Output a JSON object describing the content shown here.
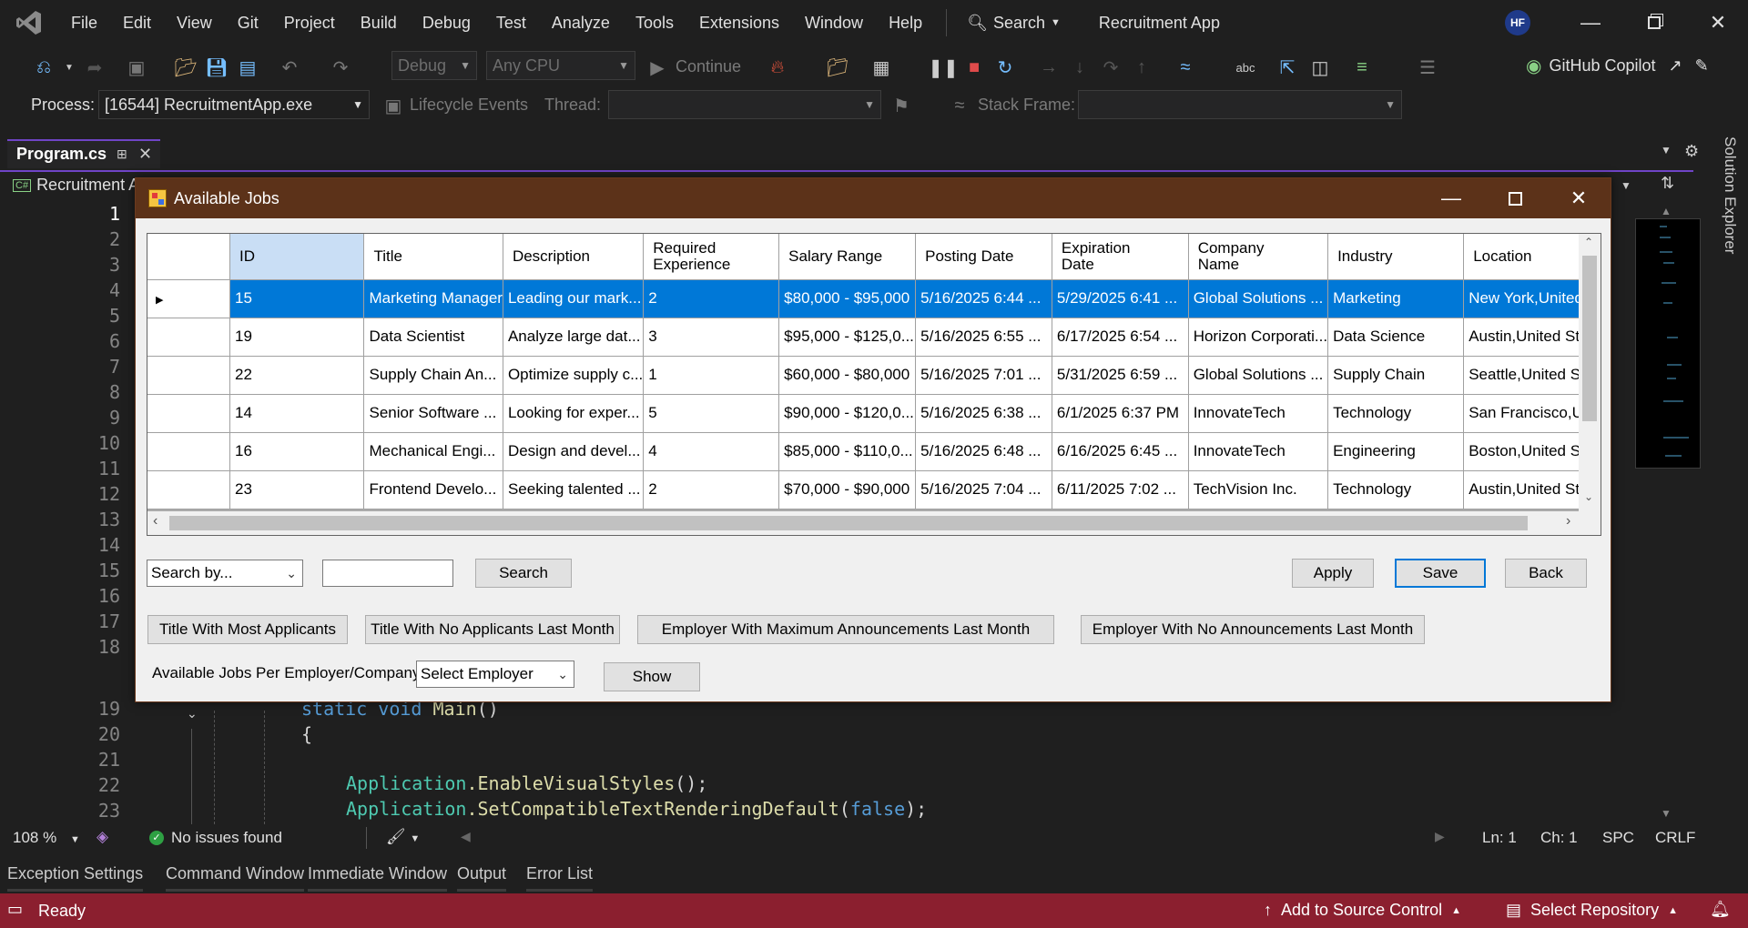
{
  "menubar": {
    "items": [
      "File",
      "Edit",
      "View",
      "Git",
      "Project",
      "Build",
      "Debug",
      "Test",
      "Analyze",
      "Tools",
      "Extensions",
      "Window",
      "Help"
    ],
    "search_label": "Search",
    "app_title": "Recruitment App",
    "avatar_initials": "HF"
  },
  "toolbar": {
    "config": "Debug",
    "platform": "Any CPU",
    "continue_label": "Continue",
    "copilot_label": "GitHub Copilot",
    "process_label": "Process:",
    "process_value": "[16544] RecruitmentApp.exe",
    "lifecycle_label": "Lifecycle Events",
    "thread_label": "Thread:",
    "stackframe_label": "Stack Frame:"
  },
  "tabs": {
    "active_file": "Program.cs",
    "project_nav": "Recruitment A",
    "solution_explorer": "Solution Explorer"
  },
  "editor": {
    "line_numbers_top": [
      "1",
      "2",
      "3",
      "4",
      "5",
      "6",
      "7",
      "8",
      "9",
      "10",
      "11",
      "12",
      "13",
      "14",
      "15",
      "16",
      "17",
      "18"
    ],
    "line_numbers_bottom": [
      "19",
      "20",
      "21",
      "22",
      "23"
    ],
    "code": {
      "l19_kw1": "static",
      "l19_kw2": "void",
      "l19_name": "Main",
      "l19_paren": "()",
      "l20": "{",
      "l22_class": "Application",
      "l22_method": ".EnableVisualStyles",
      "l22_rest": "();",
      "l23_class": "Application",
      "l23_method": ".SetCompatibleTextRenderingDefault",
      "l23_open": "(",
      "l23_kw": "false",
      "l23_close": ");"
    }
  },
  "editor_status": {
    "zoom": "108 %",
    "issues": "No issues found",
    "line": "Ln: 1",
    "char": "Ch: 1",
    "spacing": "SPC",
    "line_ending": "CRLF"
  },
  "bottom_tabs": [
    "Exception Settings",
    "Command Window",
    "Immediate Window",
    "Output",
    "Error List"
  ],
  "statusbar": {
    "ready": "Ready",
    "source_control": "Add to Source Control",
    "repository": "Select Repository"
  },
  "dialog": {
    "title": "Available Jobs",
    "grid": {
      "headers": [
        "ID",
        "Title",
        "Description",
        "Required\nExperience",
        "Salary Range",
        "Posting Date",
        "Expiration\nDate",
        "Company\nName",
        "Industry",
        "Location"
      ],
      "rows": [
        [
          "15",
          "Marketing Manager",
          "Leading our mark...",
          "2",
          "$80,000 - $95,000",
          "5/16/2025 6:44 ...",
          "5/29/2025 6:41 ...",
          "Global Solutions ...",
          "Marketing",
          "New York,United"
        ],
        [
          "19",
          "Data Scientist",
          "Analyze large dat...",
          "3",
          "$95,000 - $125,0...",
          "5/16/2025 6:55 ...",
          "6/17/2025 6:54 ...",
          "Horizon Corporati...",
          "Data Science",
          "Austin,United Sta"
        ],
        [
          "22",
          "Supply Chain An...",
          "Optimize supply c...",
          "1",
          "$60,000 - $80,000",
          "5/16/2025 7:01 ...",
          "5/31/2025 6:59 ...",
          "Global Solutions ...",
          "Supply Chain",
          "Seattle,United St"
        ],
        [
          "14",
          "Senior Software ...",
          "Looking for exper...",
          "5",
          "$90,000 - $120,0...",
          "5/16/2025 6:38 ...",
          "6/1/2025 6:37 PM",
          "InnovateTech",
          "Technology",
          "San Francisco,U"
        ],
        [
          "16",
          "Mechanical Engi...",
          "Design and devel...",
          "4",
          "$85,000 - $110,0...",
          "5/16/2025 6:48 ...",
          "6/16/2025 6:45 ...",
          "InnovateTech",
          "Engineering",
          "Boston,United St"
        ],
        [
          "23",
          "Frontend Develo...",
          "Seeking talented ...",
          "2",
          "$70,000 - $90,000",
          "5/16/2025 7:04 ...",
          "6/11/2025 7:02 ...",
          "TechVision Inc.",
          "Technology",
          "Austin,United Sta"
        ]
      ]
    },
    "search_by": "Search by...",
    "search_button": "Search",
    "apply_button": "Apply",
    "save_button": "Save",
    "back_button": "Back",
    "btn_most_applicants": "Title With Most Applicants",
    "btn_no_applicants": "Title With No Applicants Last Month",
    "btn_max_announcements": "Employer With Maximum Announcements Last Month",
    "btn_no_announcements": "Employer With No Announcements Last Month",
    "per_employer_label": "Available Jobs Per Employer/Company",
    "select_employer": "Select Employer",
    "show_button": "Show"
  }
}
